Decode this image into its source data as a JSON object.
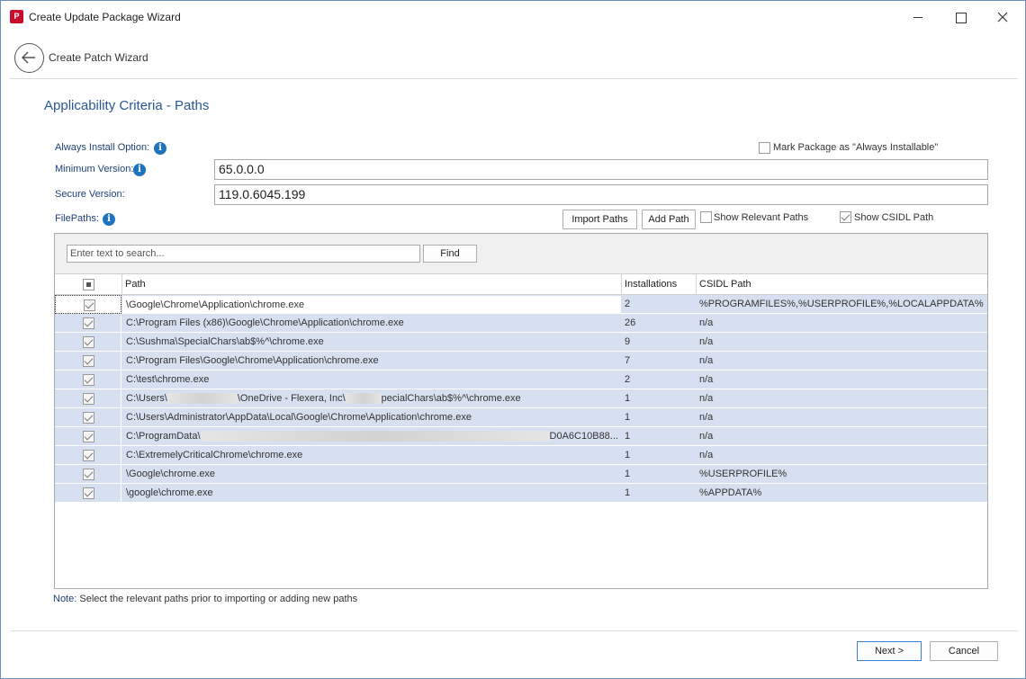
{
  "window": {
    "title": "Create Update Package Wizard",
    "app_icon_text": "P"
  },
  "header": {
    "title": "Create Patch Wizard"
  },
  "section_title": "Applicability Criteria - Paths",
  "form": {
    "always_install_label": "Always Install Option:",
    "mark_always_installable_label": "Mark Package as \"Always Installable\"",
    "minimum_version_label": "Minimum Version:",
    "minimum_version_value": "65.0.0.0",
    "secure_version_label": "Secure Version:",
    "secure_version_value": "119.0.6045.199",
    "filepaths_label": "FilePaths:",
    "info_glyph": "i"
  },
  "toolbar": {
    "import_paths": "Import Paths",
    "add_path": "Add Path",
    "show_relevant_paths": "Show Relevant Paths",
    "show_csidl_path": "Show CSIDL Path"
  },
  "search": {
    "placeholder": "Enter text to search...",
    "find_label": "Find"
  },
  "grid": {
    "columns": [
      "Path",
      "Installations",
      "CSIDL Path"
    ],
    "rows": [
      {
        "path": "\\Google\\Chrome\\Application\\chrome.exe",
        "installations": "2",
        "csidl": "%PROGRAMFILES%,%USERPROFILE%,%LOCALAPPDATA%"
      },
      {
        "path": "C:\\Program Files (x86)\\Google\\Chrome\\Application\\chrome.exe",
        "installations": "26",
        "csidl": "n/a"
      },
      {
        "path": "C:\\Sushma\\SpecialChars\\ab$%^\\chrome.exe",
        "installations": "9",
        "csidl": "n/a"
      },
      {
        "path": "C:\\Program Files\\Google\\Chrome\\Application\\chrome.exe",
        "installations": "7",
        "csidl": "n/a"
      },
      {
        "path": "C:\\test\\chrome.exe",
        "installations": "2",
        "csidl": "n/a"
      },
      {
        "path_a": "C:\\Users\\",
        "path_b": "\\OneDrive - Flexera, Inc\\",
        "path_c": "pecialChars\\ab$%^\\chrome.exe",
        "installations": "1",
        "csidl": "n/a"
      },
      {
        "path": "C:\\Users\\Administrator\\AppData\\Local\\Google\\Chrome\\Application\\chrome.exe",
        "installations": "1",
        "csidl": "n/a"
      },
      {
        "path_a": "C:\\ProgramData\\",
        "path_c": "D0A6C10B88...",
        "installations": "1",
        "csidl": "n/a"
      },
      {
        "path": "C:\\ExtremelyCriticalChrome\\chrome.exe",
        "installations": "1",
        "csidl": "n/a"
      },
      {
        "path": "\\Google\\chrome.exe",
        "installations": "1",
        "csidl": "%USERPROFILE%"
      },
      {
        "path": "\\google\\chrome.exe",
        "installations": "1",
        "csidl": "%APPDATA%"
      }
    ]
  },
  "note": {
    "label": "Note:",
    "text": "Select the relevant paths prior to importing or adding new paths"
  },
  "footer": {
    "next": "Next >",
    "cancel": "Cancel"
  }
}
